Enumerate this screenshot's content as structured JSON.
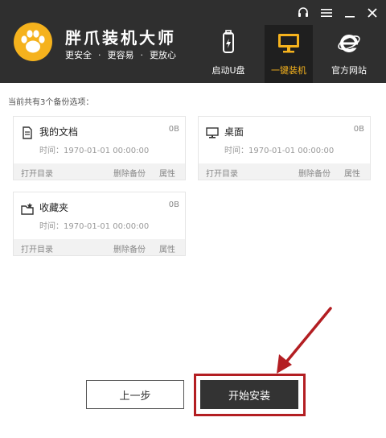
{
  "app": {
    "title": "胖爪装机大师",
    "taglines": [
      "更安全",
      "·",
      "更容易",
      "·",
      "更放心"
    ]
  },
  "window_controls": {
    "support_icon": "headset-icon",
    "menu_icon": "menu-icon",
    "minimize_icon": "minimize-icon",
    "close_icon": "close-icon"
  },
  "nav": [
    {
      "label": "启动U盘",
      "icon": "usb-drive-icon",
      "active": false
    },
    {
      "label": "一键装机",
      "icon": "monitor-icon",
      "active": true
    },
    {
      "label": "官方网站",
      "icon": "ie-browser-icon",
      "active": false
    }
  ],
  "content": {
    "count_label": "当前共有3个备份选项：",
    "backups": [
      {
        "name": "我的文档",
        "size": "0B",
        "time": "时间：1970-01-01 00:00:00",
        "icon": "document-icon",
        "open": "打开目录",
        "delete": "删除备份",
        "props": "属性"
      },
      {
        "name": "桌面",
        "size": "0B",
        "time": "时间：1970-01-01 00:00:00",
        "icon": "desktop-icon",
        "open": "打开目录",
        "delete": "删除备份",
        "props": "属性"
      },
      {
        "name": "收藏夹",
        "size": "0B",
        "time": "时间：1970-01-01 00:00:00",
        "icon": "favorites-folder-icon",
        "open": "打开目录",
        "delete": "删除备份",
        "props": "属性"
      }
    ]
  },
  "buttons": {
    "prev": "上一步",
    "start": "开始安装"
  },
  "colors": {
    "header_bg": "#2f2f2f",
    "accent": "#f5b21d",
    "highlight_frame": "#b31e22",
    "arrow": "#b31e22"
  }
}
